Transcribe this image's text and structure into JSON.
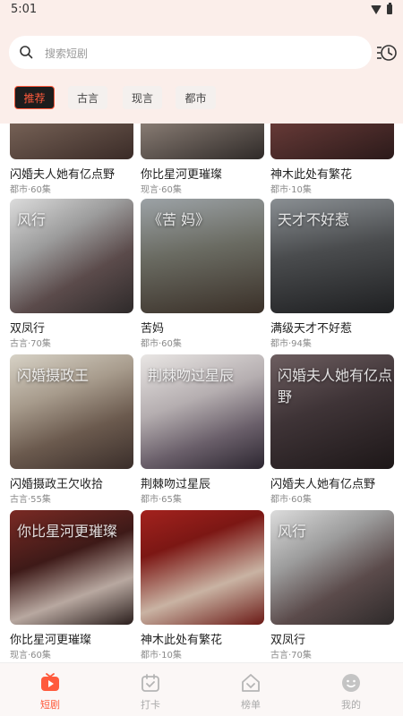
{
  "status": {
    "time": "5:01"
  },
  "search": {
    "placeholder": "搜索短剧"
  },
  "tabs": [
    {
      "label": "推荐",
      "active": true
    },
    {
      "label": "古言"
    },
    {
      "label": "现言"
    },
    {
      "label": "都市"
    }
  ],
  "cards": [
    {
      "title": "闪婚夫人她有亿点野",
      "meta": "都市·60集",
      "cover": ""
    },
    {
      "title": "你比星河更璀璨",
      "meta": "现言·60集",
      "cover": ""
    },
    {
      "title": "神木此处有繁花",
      "meta": "都市·10集",
      "cover": ""
    },
    {
      "title": "双凤行",
      "meta": "古言·70集",
      "cover": "风行"
    },
    {
      "title": "苦妈",
      "meta": "都市·60集",
      "cover": "《苦 妈》"
    },
    {
      "title": "满级天才不好惹",
      "meta": "都市·94集",
      "cover": "天才不好惹"
    },
    {
      "title": "闪婚摄政王欠收拾",
      "meta": "古言·55集",
      "cover": "闪婚摄政王"
    },
    {
      "title": "荆棘吻过星辰",
      "meta": "都市·65集",
      "cover": "荆棘吻过星辰"
    },
    {
      "title": "闪婚夫人她有亿点野",
      "meta": "都市·60集",
      "cover": "闪婚夫人她有亿点野"
    },
    {
      "title": "你比星河更璀璨",
      "meta": "现言·60集",
      "cover": "你比星河更璀璨"
    },
    {
      "title": "神木此处有繁花",
      "meta": "都市·10集",
      "cover": ""
    },
    {
      "title": "双凤行",
      "meta": "古言·70集",
      "cover": "风行"
    }
  ],
  "nav": [
    {
      "label": "短剧",
      "icon": "play-tv-icon",
      "active": true
    },
    {
      "label": "打卡",
      "icon": "calendar-check-icon"
    },
    {
      "label": "榜单",
      "icon": "ranking-house-icon"
    },
    {
      "label": "我的",
      "icon": "profile-face-icon"
    }
  ],
  "colors": {
    "accent": "#ff5a3c",
    "header_bg": "#fbeeea",
    "tab_active_bg": "#1d1d1d"
  }
}
